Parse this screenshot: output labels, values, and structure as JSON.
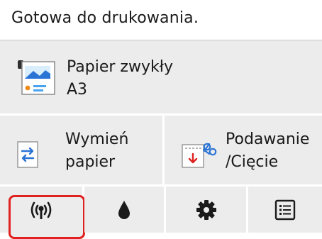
{
  "status": {
    "text": "Gotowa do drukowania."
  },
  "paper": {
    "type": "Papier zwykły",
    "size": "A3",
    "icon": "roll-paper-icon"
  },
  "actions": {
    "replace_paper": {
      "line1": "Wymień",
      "line2": "papier",
      "icon": "replace-paper-icon"
    },
    "feed_cut": {
      "line1": "Podawanie",
      "line2": "/Cięcie",
      "icon": "feed-cut-icon"
    }
  },
  "bottom_bar": {
    "items": [
      {
        "name": "wireless",
        "icon": "wireless-icon",
        "selected": true
      },
      {
        "name": "ink",
        "icon": "ink-drop-icon",
        "selected": false
      },
      {
        "name": "settings",
        "icon": "gear-icon",
        "selected": false
      },
      {
        "name": "menu",
        "icon": "list-icon",
        "selected": false
      }
    ]
  },
  "colors": {
    "panel": "#ececec",
    "selected_outline": "#e0211f",
    "accent_blue": "#2a74d6",
    "accent_red": "#e0211f"
  }
}
